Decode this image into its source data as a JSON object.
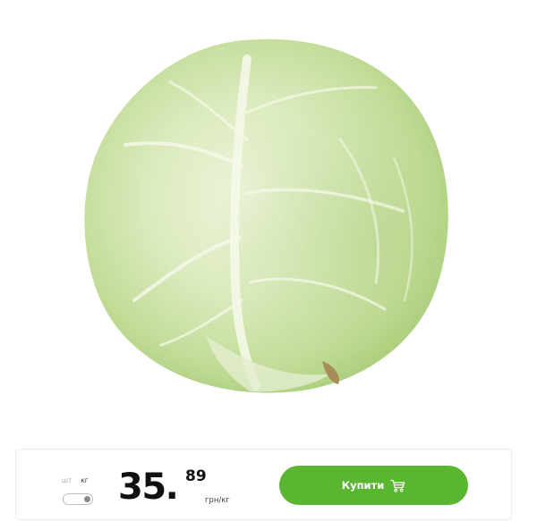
{
  "product": {
    "image_icon": "cabbage-photo"
  },
  "unit_switch": {
    "option_pieces": "шт",
    "option_kg": "кг",
    "selected": "кг"
  },
  "price": {
    "integer": "35.",
    "fraction": "89",
    "unit": "грн/кг"
  },
  "buy_button": {
    "label": "Купити",
    "icon": "cart-icon",
    "color": "#5ab531"
  }
}
